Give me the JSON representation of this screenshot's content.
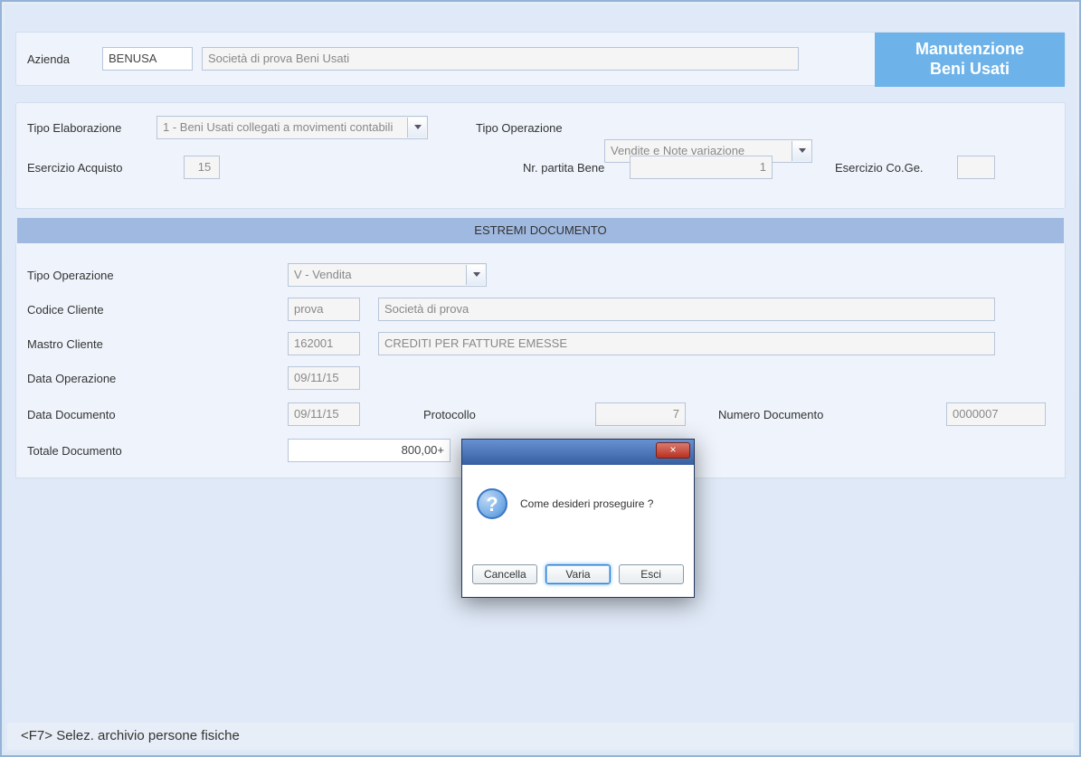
{
  "header": {
    "azienda_label": "Azienda",
    "azienda_code": "BENUSA",
    "azienda_desc": "Società di prova Beni Usati",
    "title_line1": "Manutenzione",
    "title_line2": "Beni Usati"
  },
  "params": {
    "tipo_elaborazione_label": "Tipo Elaborazione",
    "tipo_elaborazione_value": "1 - Beni Usati collegati a movimenti contabili",
    "tipo_operazione_label": "Tipo Operazione",
    "tipo_operazione_value": "Vendite e Note variazione",
    "esercizio_acquisto_label": "Esercizio Acquisto",
    "esercizio_acquisto_value": "15",
    "nr_partita_label": "Nr. partita Bene",
    "nr_partita_value": "1",
    "esercizio_coge_label": "Esercizio Co.Ge.",
    "esercizio_coge_value": ""
  },
  "section": {
    "estremi_title": "ESTREMI DOCUMENTO"
  },
  "doc": {
    "tipo_operazione_label": "Tipo Operazione",
    "tipo_operazione_value": "V - Vendita",
    "codice_cliente_label": "Codice Cliente",
    "codice_cliente_value": "prova",
    "codice_cliente_desc": "Società di prova",
    "mastro_cliente_label": "Mastro Cliente",
    "mastro_cliente_value": "162001",
    "mastro_cliente_desc": "CREDITI PER FATTURE EMESSE",
    "data_operazione_label": "Data Operazione",
    "data_operazione_value": "09/11/15",
    "data_documento_label": "Data Documento",
    "data_documento_value": "09/11/15",
    "protocollo_label": "Protocollo",
    "protocollo_value": "7",
    "numero_documento_label": "Numero Documento",
    "numero_documento_value": "0000007",
    "totale_documento_label": "Totale Documento",
    "totale_documento_value": "800,00+"
  },
  "dialog": {
    "message": "Come desideri proseguire ?",
    "btn_cancella": "Cancella",
    "btn_varia": "Varia",
    "btn_esci": "Esci",
    "close_glyph": "×"
  },
  "status": {
    "text": "<F7> Selez. archivio persone fisiche"
  }
}
